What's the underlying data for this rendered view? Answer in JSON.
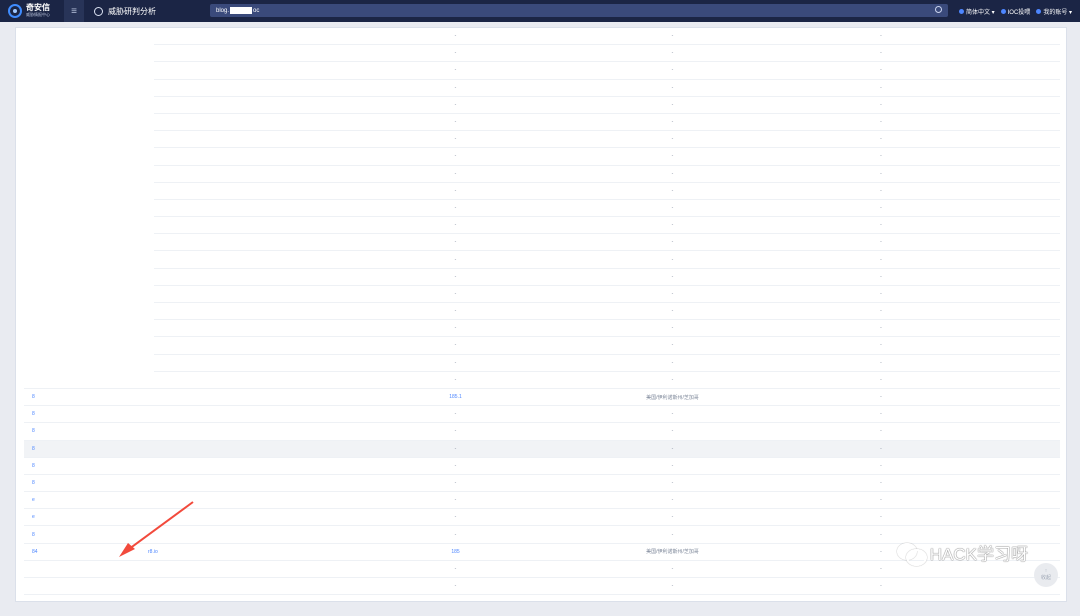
{
  "app": {
    "brand_name": "奇安信",
    "brand_sub": "威胁情报中心",
    "module_title": "威胁研判分析"
  },
  "search": {
    "prefix": "blog.",
    "suffix": "oc"
  },
  "top_menu": {
    "language": "简体中文 ▾",
    "ioc": "IOC投喂",
    "account": "我的账号 ▾"
  },
  "colors": {
    "topbar": "#1b2545",
    "accent": "#4d86ff",
    "arrow": "#f24a3c"
  },
  "table": {
    "rows": [
      {
        "a": "",
        "b": "",
        "c": "-",
        "d": "-",
        "e": "-"
      },
      {
        "a": "",
        "b": "",
        "c": "-",
        "d": "-",
        "e": "-"
      },
      {
        "a": "",
        "b": "",
        "c": "-",
        "d": "-",
        "e": "-"
      },
      {
        "a": "",
        "b": "",
        "c": "-",
        "d": "-",
        "e": "-"
      },
      {
        "a": "",
        "b": "",
        "c": "-",
        "d": "-",
        "e": "-"
      },
      {
        "a": "",
        "b": "",
        "c": "-",
        "d": "-",
        "e": "-"
      },
      {
        "a": "",
        "b": "",
        "c": "-",
        "d": "-",
        "e": "-"
      },
      {
        "a": "",
        "b": "",
        "c": "-",
        "d": "-",
        "e": "-"
      },
      {
        "a": "",
        "b": "",
        "c": "-",
        "d": "-",
        "e": "-"
      },
      {
        "a": "",
        "b": "",
        "c": "-",
        "d": "-",
        "e": "-"
      },
      {
        "a": "",
        "b": "",
        "c": "-",
        "d": "-",
        "e": "-"
      },
      {
        "a": "",
        "b": "",
        "c": "-",
        "d": "-",
        "e": "-"
      },
      {
        "a": "",
        "b": "",
        "c": "-",
        "d": "-",
        "e": "-"
      },
      {
        "a": "",
        "b": "",
        "c": "-",
        "d": "-",
        "e": "-"
      },
      {
        "a": "",
        "b": "",
        "c": "-",
        "d": "-",
        "e": "-"
      },
      {
        "a": "",
        "b": "",
        "c": "-",
        "d": "-",
        "e": "-"
      },
      {
        "a": "",
        "b": "",
        "c": "-",
        "d": "-",
        "e": "-"
      },
      {
        "a": "",
        "b": "",
        "c": "-",
        "d": "-",
        "e": "-"
      },
      {
        "a": "",
        "b": "",
        "c": "-",
        "d": "-",
        "e": "-"
      },
      {
        "a": "",
        "b": "",
        "c": "-",
        "d": "-",
        "e": "-"
      },
      {
        "a": "",
        "b": "",
        "c": "-",
        "d": "-",
        "e": "-"
      },
      {
        "a": "8",
        "b": "",
        "c": "185.1",
        "d": "美国/伊利诺斯州/芝加哥",
        "e": "-"
      },
      {
        "a": "8",
        "b": "",
        "c": "-",
        "d": "-",
        "e": "-"
      },
      {
        "a": "8",
        "b": "",
        "c": "-",
        "d": "-",
        "e": "-"
      },
      {
        "a": "8",
        "b": "",
        "c": "-",
        "d": "-",
        "e": "-"
      },
      {
        "a": "8",
        "b": "",
        "c": "-",
        "d": "-",
        "e": "-"
      },
      {
        "a": "8",
        "b": "",
        "c": "-",
        "d": "-",
        "e": "-"
      },
      {
        "a": "e",
        "b": "",
        "c": "-",
        "d": "-",
        "e": "-"
      },
      {
        "a": "e",
        "b": "",
        "c": "-",
        "d": "-",
        "e": "-"
      },
      {
        "a": "8",
        "b": "",
        "c": "-",
        "d": "-",
        "e": "-"
      },
      {
        "a": "84",
        "b": "r8.io",
        "c": "185",
        "d": "美国/伊利诺斯州/芝加哥",
        "e": "-"
      },
      {
        "a": "",
        "b": "",
        "c": "-",
        "d": "-",
        "e": "-"
      },
      {
        "a": "",
        "b": "",
        "c": "-",
        "d": "-",
        "e": "-"
      }
    ]
  },
  "watermark": {
    "text": "HACK学习呀"
  },
  "scroll": {
    "label": "收起"
  }
}
